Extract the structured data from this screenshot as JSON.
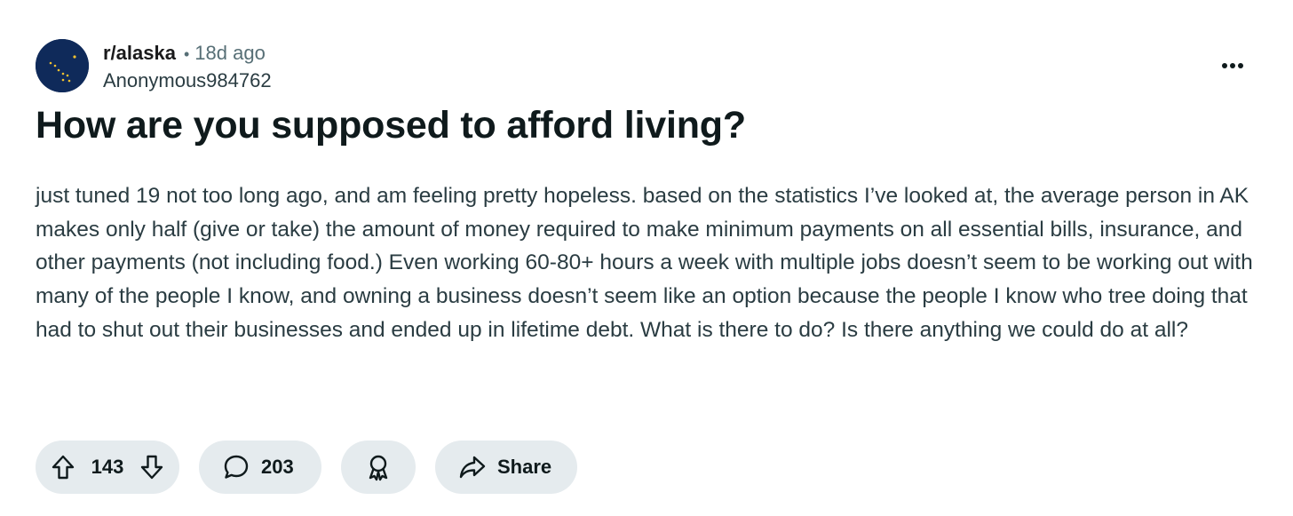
{
  "post": {
    "subreddit": "r/alaska",
    "separator": "•",
    "age": "18d ago",
    "author": "Anonymous984762",
    "title": "How are you supposed to afford living?",
    "body": "just tuned 19 not too long ago, and am feeling pretty hopeless. based on the statistics I’ve looked at, the average person in AK makes only half (give or take) the amount of money required to make minimum payments on all essential bills, insurance, and other payments (not including food.) Even working 60-80+ hours a week with multiple jobs doesn’t seem to be working out with many of the people I know, and owning a business doesn’t seem like an option because the people I know who tree doing that had to shut out their businesses and ended up in lifetime debt. What is there to do? Is there anything we could do at all?"
  },
  "actions": {
    "score": "143",
    "comments": "203",
    "share_label": "Share"
  },
  "icons": {
    "avatar": "alaska-flag-icon",
    "overflow": "more-horizontal-icon",
    "upvote": "upvote-arrow-icon",
    "downvote": "downvote-arrow-icon",
    "comment": "comment-bubble-icon",
    "award": "award-icon",
    "share": "share-arrow-icon"
  },
  "colors": {
    "pill_background": "#e5ebee",
    "avatar_background": "#0f2a5a",
    "avatar_stars": "#f2c230",
    "muted_text": "#576f76"
  }
}
